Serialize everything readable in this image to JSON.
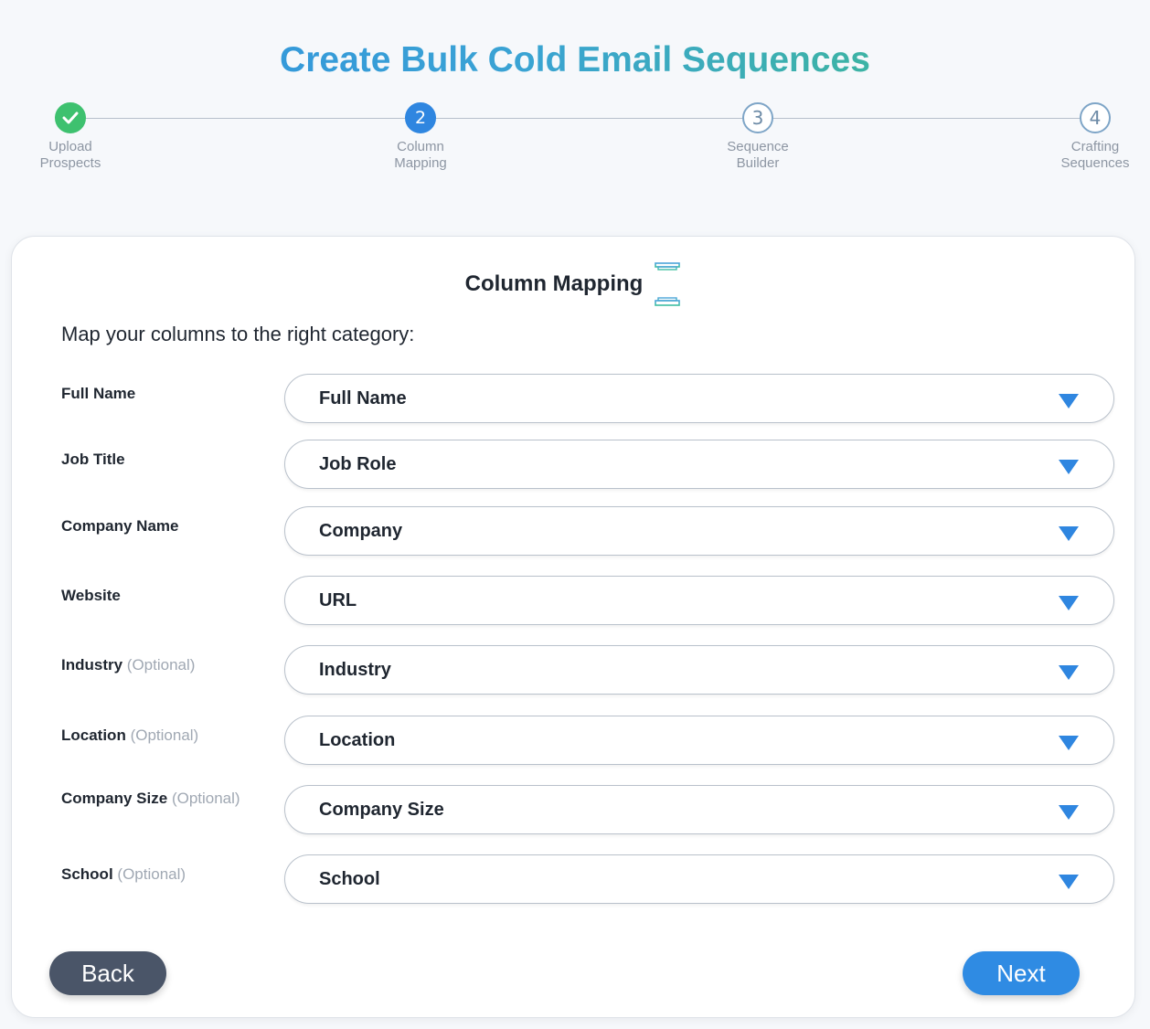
{
  "header": {
    "title": "Create Bulk Cold Email Sequences"
  },
  "stepper": {
    "steps": [
      {
        "number": "✓",
        "label_line1": "Upload",
        "label_line2": "Prospects",
        "state": "done"
      },
      {
        "number": "2",
        "label_line1": "Column",
        "label_line2": "Mapping",
        "state": "active"
      },
      {
        "number": "3",
        "label_line1": "Sequence",
        "label_line2": "Builder",
        "state": "pending"
      },
      {
        "number": "4",
        "label_line1": "Crafting",
        "label_line2": "Sequences",
        "state": "pending"
      }
    ]
  },
  "card": {
    "title": "Column Mapping",
    "title_icon": "column-pillar-icon",
    "subtitle": "Map your columns to the right category:",
    "rows": [
      {
        "label": "Full Name",
        "optional": "",
        "value": "Full Name"
      },
      {
        "label": "Job Title",
        "optional": "",
        "value": "Job Role"
      },
      {
        "label": "Company Name",
        "optional": "",
        "value": "Company"
      },
      {
        "label": "Website",
        "optional": "",
        "value": "URL"
      },
      {
        "label": "Industry",
        "optional": "(Optional)",
        "value": "Industry"
      },
      {
        "label": "Location",
        "optional": "(Optional)",
        "value": "Location"
      },
      {
        "label": "Company Size",
        "optional": "(Optional)",
        "value": "Company Size"
      },
      {
        "label": "School",
        "optional": "(Optional)",
        "value": "School"
      }
    ]
  },
  "footer": {
    "back_label": "Back",
    "next_label": "Next"
  },
  "colors": {
    "accent": "#2f86e0",
    "success": "#3ec16f",
    "back_button": "#4a5568"
  }
}
